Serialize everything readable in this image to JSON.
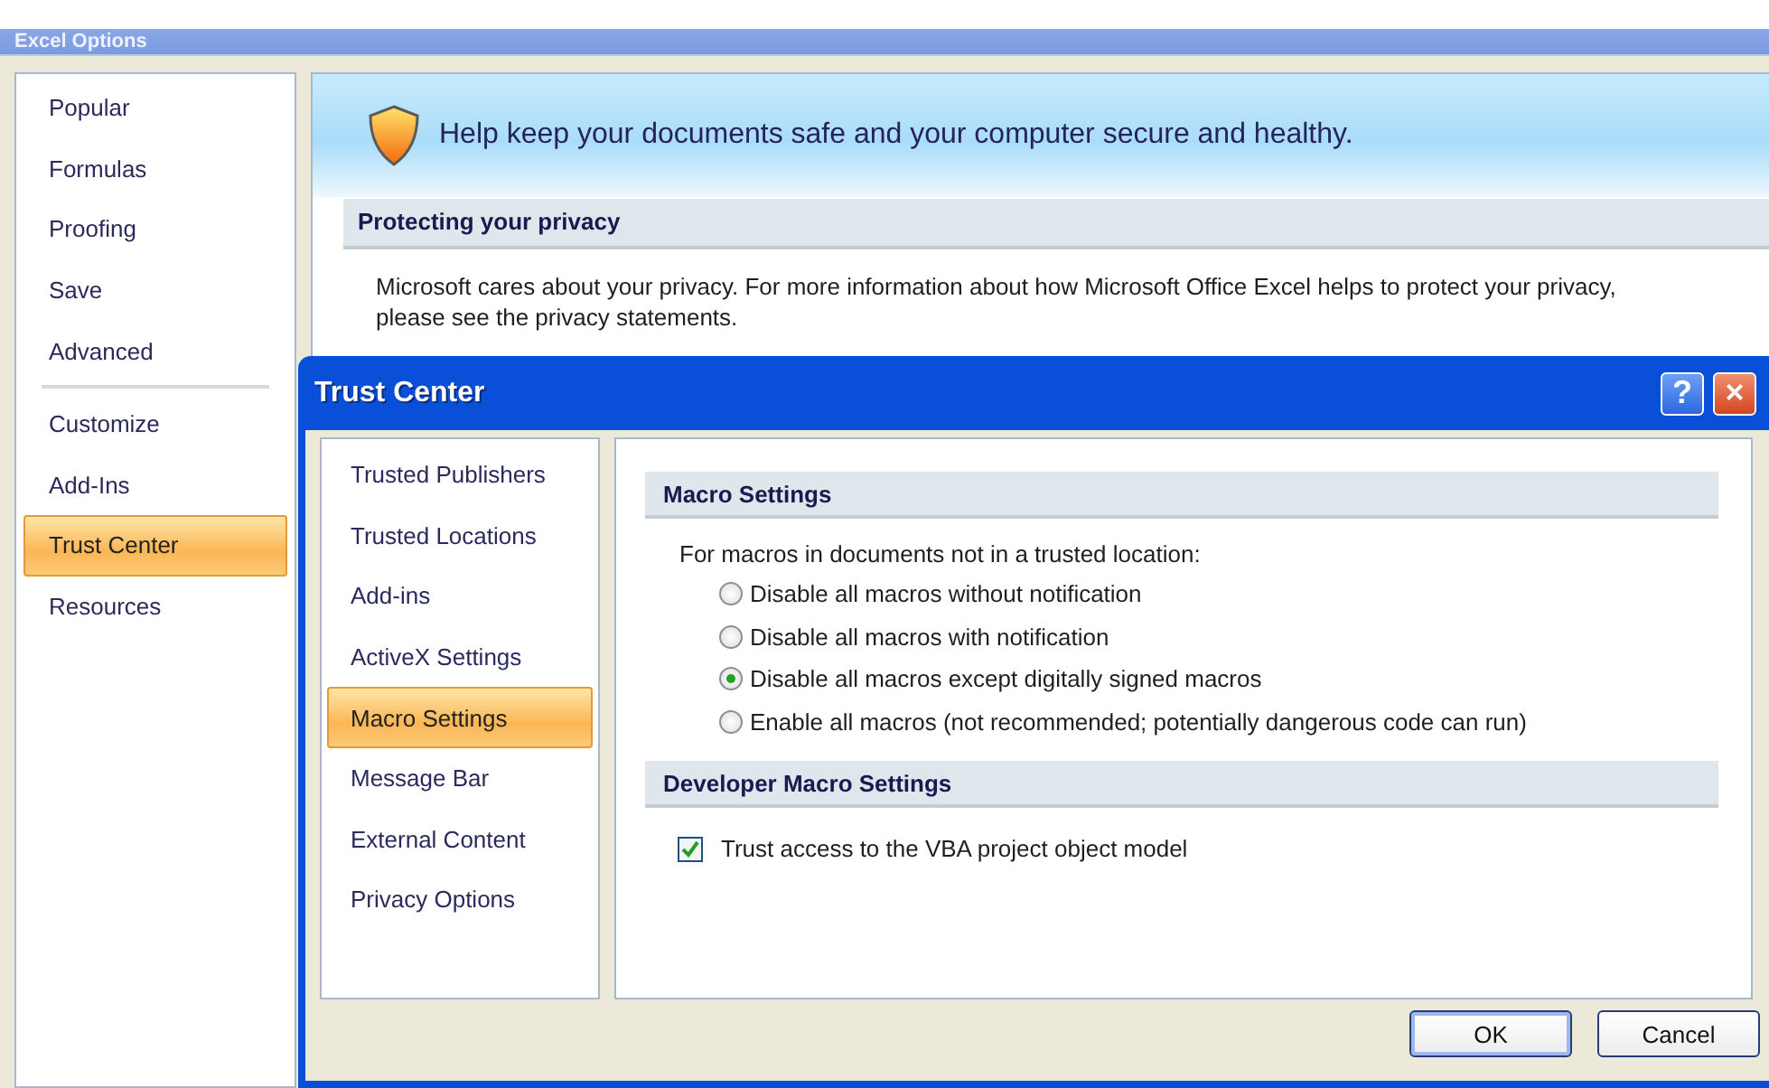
{
  "window": {
    "title": "Excel Options"
  },
  "sidebar": {
    "items": [
      {
        "label": "Popular",
        "selected": false
      },
      {
        "label": "Formulas",
        "selected": false
      },
      {
        "label": "Proofing",
        "selected": false
      },
      {
        "label": "Save",
        "selected": false
      },
      {
        "label": "Advanced",
        "selected": false
      },
      {
        "label": "Customize",
        "selected": false,
        "separator_before": true
      },
      {
        "label": "Add-Ins",
        "selected": false
      },
      {
        "label": "Trust Center",
        "selected": true
      },
      {
        "label": "Resources",
        "selected": false
      }
    ]
  },
  "banner": {
    "text": "Help keep your documents safe and your computer secure and healthy."
  },
  "privacy": {
    "heading": "Protecting your privacy",
    "text": "Microsoft cares about your privacy. For more information about how Microsoft Office Excel helps to protect your privacy, please see the privacy statements."
  },
  "dialog": {
    "title": "Trust Center",
    "help": "?",
    "close": "×",
    "sidebar": {
      "items": [
        {
          "label": "Trusted Publishers",
          "selected": false
        },
        {
          "label": "Trusted Locations",
          "selected": false
        },
        {
          "label": "Add-ins",
          "selected": false
        },
        {
          "label": "ActiveX Settings",
          "selected": false
        },
        {
          "label": "Macro Settings",
          "selected": true
        },
        {
          "label": "Message Bar",
          "selected": false
        },
        {
          "label": "External Content",
          "selected": false
        },
        {
          "label": "Privacy Options",
          "selected": false
        }
      ]
    },
    "macro_settings": {
      "heading": "Macro Settings",
      "intro": "For macros in documents not in a trusted location:",
      "options": [
        {
          "label": "Disable all macros without notification",
          "selected": false
        },
        {
          "label": "Disable all macros with notification",
          "selected": false
        },
        {
          "label": "Disable all macros except digitally signed macros",
          "selected": true
        },
        {
          "label": "Enable all macros (not recommended; potentially dangerous code can run)",
          "selected": false
        }
      ]
    },
    "developer": {
      "heading": "Developer Macro Settings",
      "checkbox": {
        "label": "Trust access to the VBA project object model",
        "checked": true
      }
    },
    "buttons": [
      {
        "label": "OK",
        "kind": "default"
      },
      {
        "label": "Cancel",
        "kind": "normal"
      }
    ]
  }
}
